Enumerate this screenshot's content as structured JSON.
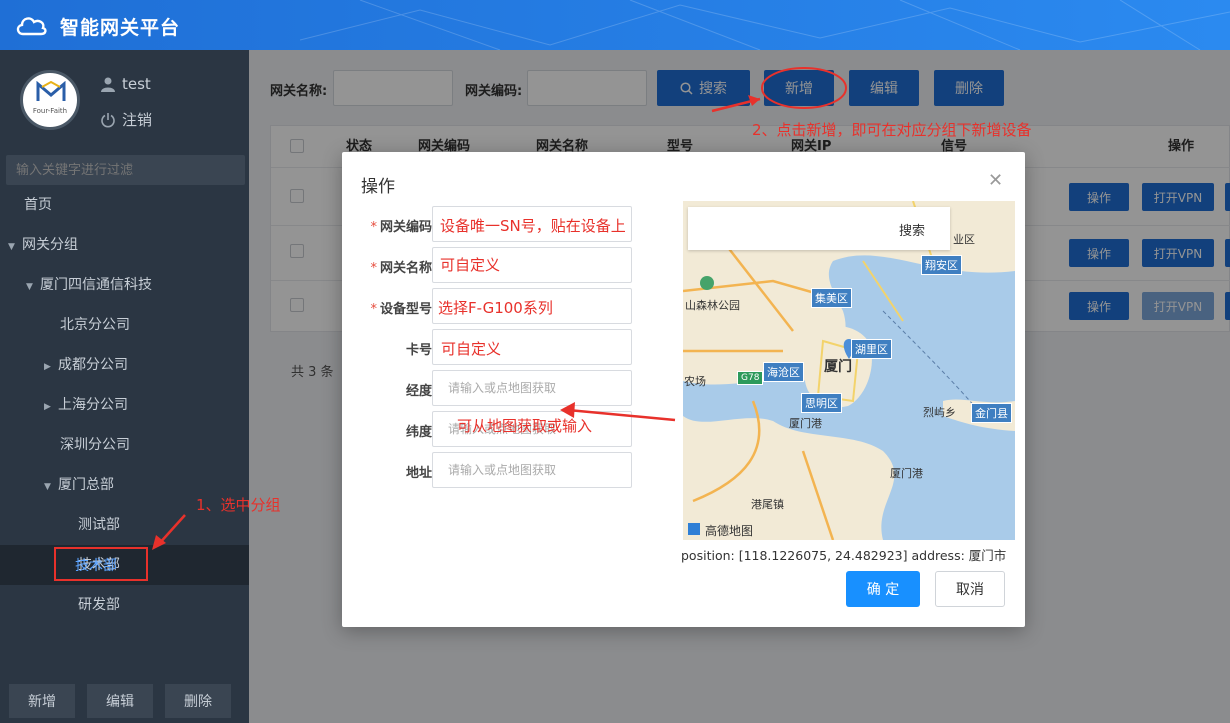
{
  "header": {
    "title": "智能网关平台"
  },
  "sidebar": {
    "avatar_brand": "Four-Faith",
    "user": "test",
    "logout": "注销",
    "filter_placeholder": "输入关键字进行过滤",
    "items": [
      {
        "label": "首页"
      },
      {
        "label": "网关分组"
      },
      {
        "label": "厦门四信通信科技"
      },
      {
        "label": "北京分公司"
      },
      {
        "label": "成都分公司"
      },
      {
        "label": "上海分公司"
      },
      {
        "label": "深圳分公司"
      },
      {
        "label": "厦门总部"
      },
      {
        "label": "测试部"
      },
      {
        "label": "技术部"
      },
      {
        "label": "研发部"
      }
    ],
    "buttons": {
      "add": "新增",
      "edit": "编辑",
      "delete": "删除"
    }
  },
  "toolbar": {
    "gw_name_label": "网关名称:",
    "gw_code_label": "网关编码:",
    "search": "搜索",
    "add": "新增",
    "edit": "编辑",
    "delete": "删除"
  },
  "table": {
    "headers": [
      "状态",
      "网关编码",
      "网关名称",
      "型号",
      "网关IP",
      "信号",
      "操作"
    ],
    "row_buttons": {
      "op": "操作",
      "vpn": "打开VPN"
    },
    "total": "共 3 条"
  },
  "modal": {
    "title": "操作",
    "fields": [
      {
        "label": "网关编码",
        "required": "*",
        "placeholder": ""
      },
      {
        "label": "网关名称",
        "required": "*",
        "placeholder": ""
      },
      {
        "label": "设备型号",
        "required": "*",
        "placeholder": ""
      },
      {
        "label": "卡号",
        "required": "",
        "placeholder": ""
      },
      {
        "label": "经度",
        "required": "",
        "placeholder": "请输入或点地图获取"
      },
      {
        "label": "纬度",
        "required": "",
        "placeholder": "请输入或点地图获取"
      },
      {
        "label": "地址",
        "required": "",
        "placeholder": "请输入或点地图获取"
      }
    ],
    "map": {
      "search": "搜索",
      "labels": [
        "业区",
        "翔安区",
        "山森林公园",
        "集美区",
        "湖里区",
        "海沧区",
        "厦门",
        "农场",
        "思明区",
        "厦门港",
        "烈屿乡",
        "金门县",
        "港尾镇",
        "G78"
      ],
      "watermark": "高德地图"
    },
    "position_text": "position: [118.1226075, 24.482923] address: 厦门市",
    "ok": "确 定",
    "cancel": "取消"
  },
  "annotations": {
    "a1": "1、选中分组",
    "a2": "2、点击新增，即可在对应分组下新增设备",
    "sn": "设备唯一SN号，贴在设备上",
    "custom1": "可自定义",
    "model": "选择F-G100系列",
    "custom2": "可自定义",
    "map": "可从地图获取或输入"
  },
  "colors": {
    "primary": "#1f6fd6",
    "sidebar": "#2b3643",
    "annotation": "#e8312b"
  }
}
